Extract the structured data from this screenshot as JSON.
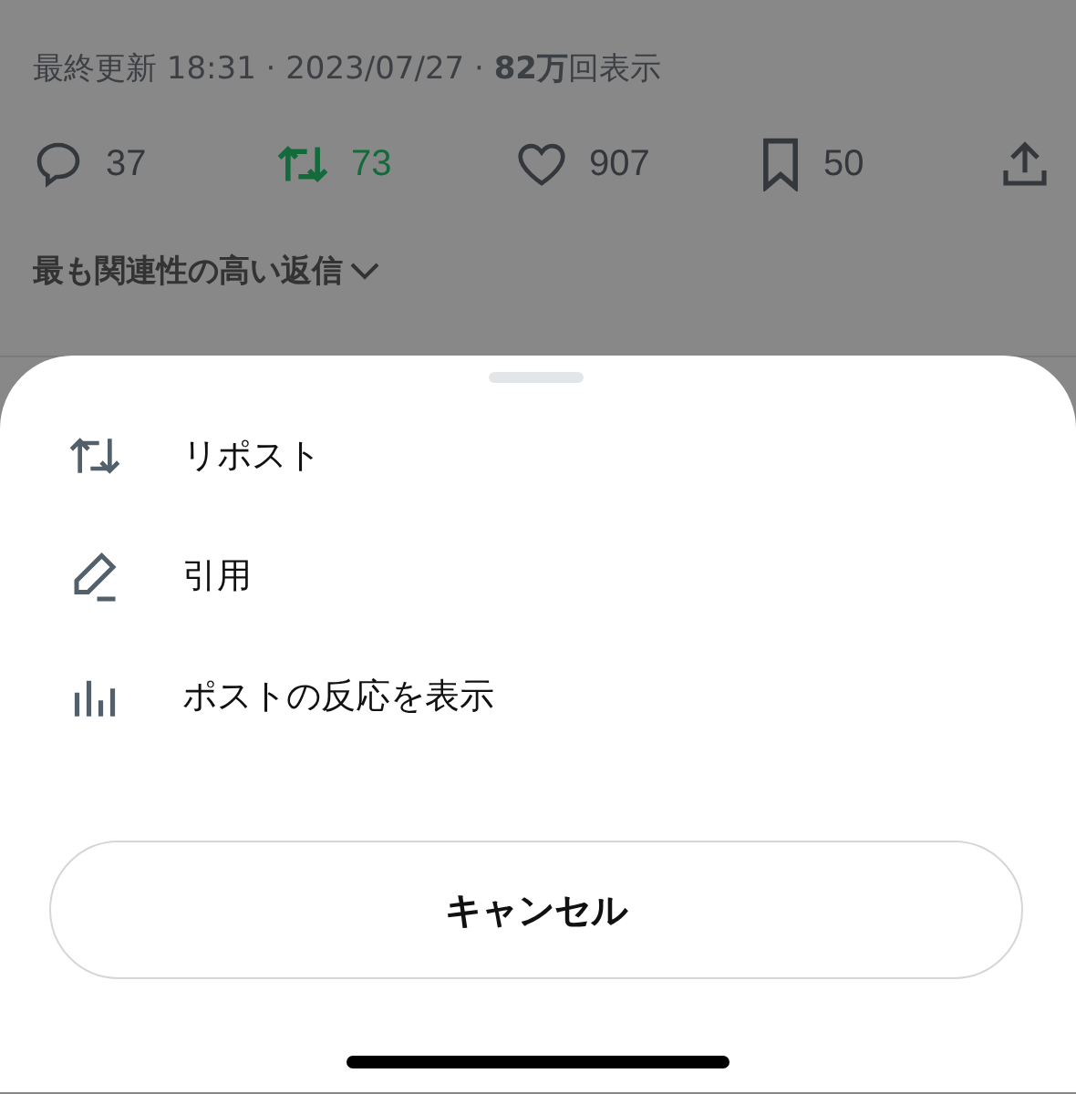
{
  "post": {
    "meta": "最終更新 18:31 · 2023/07/27 · **82万**回表示",
    "actions": [
      {
        "kind": "reply",
        "count": "37",
        "active": false
      },
      {
        "kind": "repost",
        "count": "73",
        "active": true
      },
      {
        "kind": "like",
        "count": "907",
        "active": false
      },
      {
        "kind": "bookmark",
        "count": "50",
        "active": false
      },
      {
        "kind": "share",
        "active": false
      }
    ],
    "sort": "最も関連性の高い返信"
  },
  "sheet": {
    "items": [
      {
        "kind": "repost",
        "label": "リポスト"
      },
      {
        "kind": "quote",
        "label": "引用"
      },
      {
        "kind": "analytics",
        "label": "ポストの反応を表示"
      }
    ],
    "cancel": "キャンセル"
  }
}
